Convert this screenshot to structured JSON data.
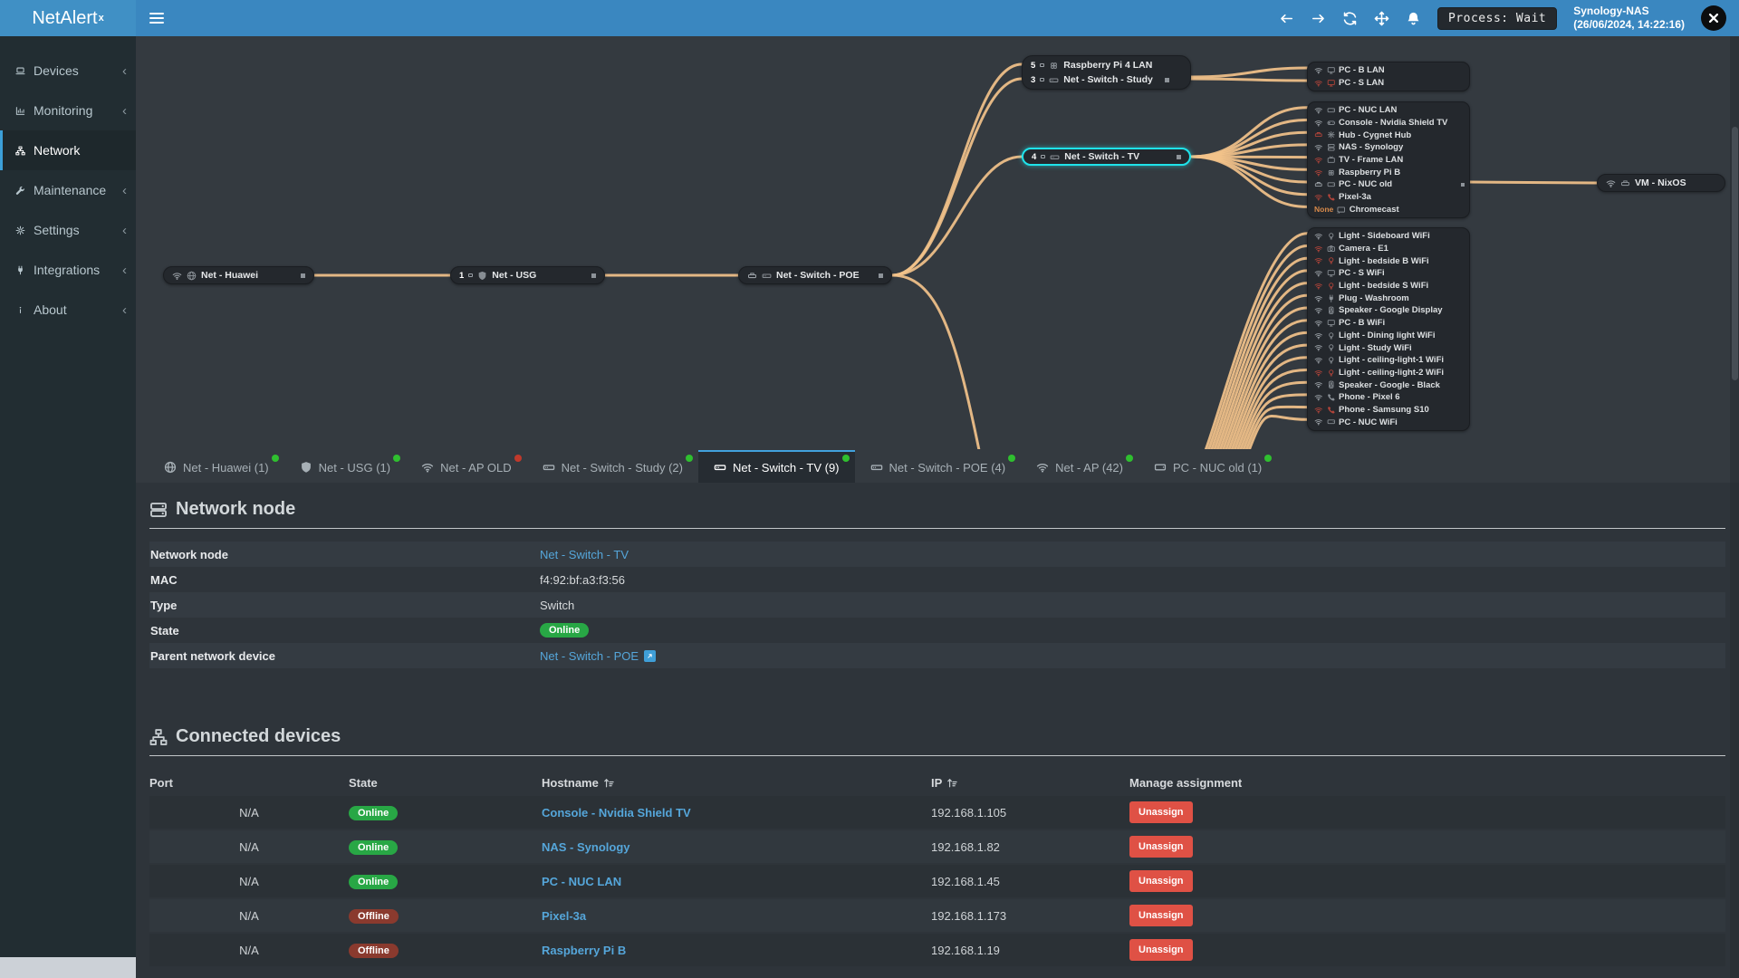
{
  "colors": {
    "navbar": "#3a87c0",
    "edge": "#f2c28a",
    "online": "#28a745",
    "offline": "#8a3a2e",
    "danger": "#df5145",
    "link": "#55a6da",
    "selected": "#1fe3ea",
    "dot_green": "#2fbf2f",
    "dot_red": "#c0392b",
    "status_gray": "#9aa0a6",
    "status_red": "#b0443a",
    "none_orange": "#d98a4a"
  },
  "header": {
    "logo_text": "NetAlert",
    "logo_sup": "x",
    "process_label": "Process: Wait",
    "host_name": "Synology-NAS",
    "host_time": "(26/06/2024, 14:22:16)"
  },
  "sidebar": {
    "items": [
      {
        "label": "Devices",
        "icon": "laptop",
        "chevron": true
      },
      {
        "label": "Monitoring",
        "icon": "chart",
        "chevron": true
      },
      {
        "label": "Network",
        "icon": "sitemap",
        "active": true,
        "chevron": false
      },
      {
        "label": "Maintenance",
        "icon": "wrench",
        "chevron": true
      },
      {
        "label": "Settings",
        "icon": "gear",
        "chevron": true
      },
      {
        "label": "Integrations",
        "icon": "plug",
        "chevron": true
      },
      {
        "label": "About",
        "icon": "info",
        "chevron": true
      }
    ]
  },
  "diagram": {
    "nodes": {
      "huawei": {
        "label": "Net - Huawei"
      },
      "usg": {
        "label": "Net - USG",
        "count": "1"
      },
      "poe": {
        "label": "Net - Switch - POE"
      },
      "group": {
        "rows": [
          {
            "count": "5",
            "icon": "raspberry",
            "label": "Raspberry Pi 4 LAN"
          },
          {
            "count": "3",
            "icon": "switch",
            "label": "Net - Switch - Study"
          }
        ]
      },
      "tv": {
        "label": "Net - Switch - TV",
        "count": "4",
        "selected": true
      },
      "vm": {
        "label": "VM - NixOS"
      }
    },
    "clusters": [
      {
        "id": "lan-study",
        "items": [
          {
            "status": "wifi",
            "sc": "gray",
            "icon": "monitor",
            "ic": "gray",
            "label": "PC - B LAN"
          },
          {
            "status": "wifi",
            "sc": "red",
            "icon": "monitor",
            "ic": "red",
            "label": "PC - S LAN"
          }
        ]
      },
      {
        "id": "lan-tv",
        "items": [
          {
            "status": "wifi",
            "sc": "gray",
            "icon": "pc",
            "ic": "gray",
            "label": "PC - NUC LAN"
          },
          {
            "status": "wifi",
            "sc": "gray",
            "icon": "gamepad",
            "ic": "gray",
            "label": "Console - Nvidia Shield TV"
          },
          {
            "status": "eth",
            "sc": "red",
            "icon": "hub",
            "ic": "gray",
            "label": "Hub - Cygnet Hub"
          },
          {
            "status": "wifi",
            "sc": "gray",
            "icon": "nas",
            "ic": "gray",
            "label": "NAS - Synology"
          },
          {
            "status": "wifi",
            "sc": "red",
            "icon": "tv",
            "ic": "gray",
            "label": "TV - Frame LAN"
          },
          {
            "status": "wifi",
            "sc": "red",
            "icon": "raspberry",
            "ic": "gray",
            "label": "Raspberry Pi B"
          },
          {
            "status": "eth",
            "sc": "gray",
            "icon": "pc",
            "ic": "gray",
            "label": "PC - NUC old",
            "handle": true
          },
          {
            "status": "wifi",
            "sc": "red",
            "icon": "phone",
            "ic": "red",
            "label": "Pixel-3a"
          },
          {
            "prefix": "None",
            "icon": "cast",
            "ic": "gray",
            "label": "Chromecast"
          }
        ]
      },
      {
        "id": "wifi-ap",
        "items": [
          {
            "status": "wifi",
            "sc": "gray",
            "icon": "bulb",
            "ic": "gray",
            "label": "Light - Sideboard WiFi"
          },
          {
            "status": "wifi",
            "sc": "red",
            "icon": "camera",
            "ic": "gray",
            "label": "Camera - E1"
          },
          {
            "status": "wifi",
            "sc": "red",
            "icon": "bulb",
            "ic": "red",
            "label": "Light - bedside B WiFi"
          },
          {
            "status": "wifi",
            "sc": "gray",
            "icon": "monitor",
            "ic": "gray",
            "label": "PC - S WiFi"
          },
          {
            "status": "wifi",
            "sc": "red",
            "icon": "bulb",
            "ic": "red",
            "label": "Light - bedside S WiFi"
          },
          {
            "status": "wifi",
            "sc": "gray",
            "icon": "plug",
            "ic": "gray",
            "label": "Plug - Washroom"
          },
          {
            "status": "wifi",
            "sc": "gray",
            "icon": "speaker",
            "ic": "gray",
            "label": "Speaker - Google Display"
          },
          {
            "status": "wifi",
            "sc": "gray",
            "icon": "monitor",
            "ic": "gray",
            "label": "PC - B WiFi"
          },
          {
            "status": "wifi",
            "sc": "gray",
            "icon": "bulb",
            "ic": "gray",
            "label": "Light - Dining light WiFi"
          },
          {
            "status": "wifi",
            "sc": "gray",
            "icon": "bulb",
            "ic": "gray",
            "label": "Light - Study WiFi"
          },
          {
            "status": "wifi",
            "sc": "gray",
            "icon": "bulb",
            "ic": "gray",
            "label": "Light - ceiling-light-1 WiFi"
          },
          {
            "status": "wifi",
            "sc": "red",
            "icon": "bulb",
            "ic": "red",
            "label": "Light - ceiling-light-2 WiFi"
          },
          {
            "status": "wifi",
            "sc": "gray",
            "icon": "speaker",
            "ic": "gray",
            "label": "Speaker - Google - Black"
          },
          {
            "status": "wifi",
            "sc": "gray",
            "icon": "phone",
            "ic": "gray",
            "label": "Phone - Pixel 6"
          },
          {
            "status": "wifi",
            "sc": "red",
            "icon": "phone",
            "ic": "red",
            "label": "Phone - Samsung S10"
          },
          {
            "status": "wifi",
            "sc": "gray",
            "icon": "pc",
            "ic": "gray",
            "label": "PC - NUC WiFi"
          }
        ]
      }
    ]
  },
  "tabs": [
    {
      "label": "Net - Huawei (1)",
      "icon": "globe",
      "dot": "green"
    },
    {
      "label": "Net - USG (1)",
      "icon": "shield",
      "dot": "green"
    },
    {
      "label": "Net - AP OLD",
      "icon": "wifi",
      "dot": "red"
    },
    {
      "label": "Net - Switch - Study (2)",
      "icon": "switch",
      "dot": "green"
    },
    {
      "label": "Net - Switch - TV (9)",
      "icon": "switch",
      "dot": "green",
      "active": true
    },
    {
      "label": "Net - Switch - POE (4)",
      "icon": "switch",
      "dot": "green"
    },
    {
      "label": "Net - AP (42)",
      "icon": "wifi",
      "dot": "green"
    },
    {
      "label": "PC - NUC old (1)",
      "icon": "pc",
      "dot": "green"
    }
  ],
  "node_panel": {
    "title": "Network node",
    "rows": [
      {
        "label": "Network node",
        "value": "Net - Switch - TV",
        "kind": "link"
      },
      {
        "label": "MAC",
        "value": "f4:92:bf:a3:f3:56",
        "kind": "text"
      },
      {
        "label": "Type",
        "value": "Switch",
        "kind": "text"
      },
      {
        "label": "State",
        "value": "Online",
        "kind": "badge"
      },
      {
        "label": "Parent network device",
        "value": "Net - Switch - POE",
        "kind": "link-ext"
      }
    ]
  },
  "devices_panel": {
    "title": "Connected devices",
    "columns": [
      {
        "label": "Port"
      },
      {
        "label": "State"
      },
      {
        "label": "Hostname",
        "sortable": true
      },
      {
        "label": "IP",
        "sortable": true
      },
      {
        "label": "Manage assignment"
      }
    ],
    "rows": [
      {
        "port": "N/A",
        "state": "Online",
        "hostname": "Console - Nvidia Shield TV",
        "ip": "192.168.1.105",
        "action": "Unassign"
      },
      {
        "port": "N/A",
        "state": "Online",
        "hostname": "NAS - Synology",
        "ip": "192.168.1.82",
        "action": "Unassign"
      },
      {
        "port": "N/A",
        "state": "Online",
        "hostname": "PC - NUC LAN",
        "ip": "192.168.1.45",
        "action": "Unassign"
      },
      {
        "port": "N/A",
        "state": "Offline",
        "hostname": "Pixel-3a",
        "ip": "192.168.1.173",
        "action": "Unassign"
      },
      {
        "port": "N/A",
        "state": "Offline",
        "hostname": "Raspberry Pi B",
        "ip": "192.168.1.19",
        "action": "Unassign"
      }
    ]
  }
}
